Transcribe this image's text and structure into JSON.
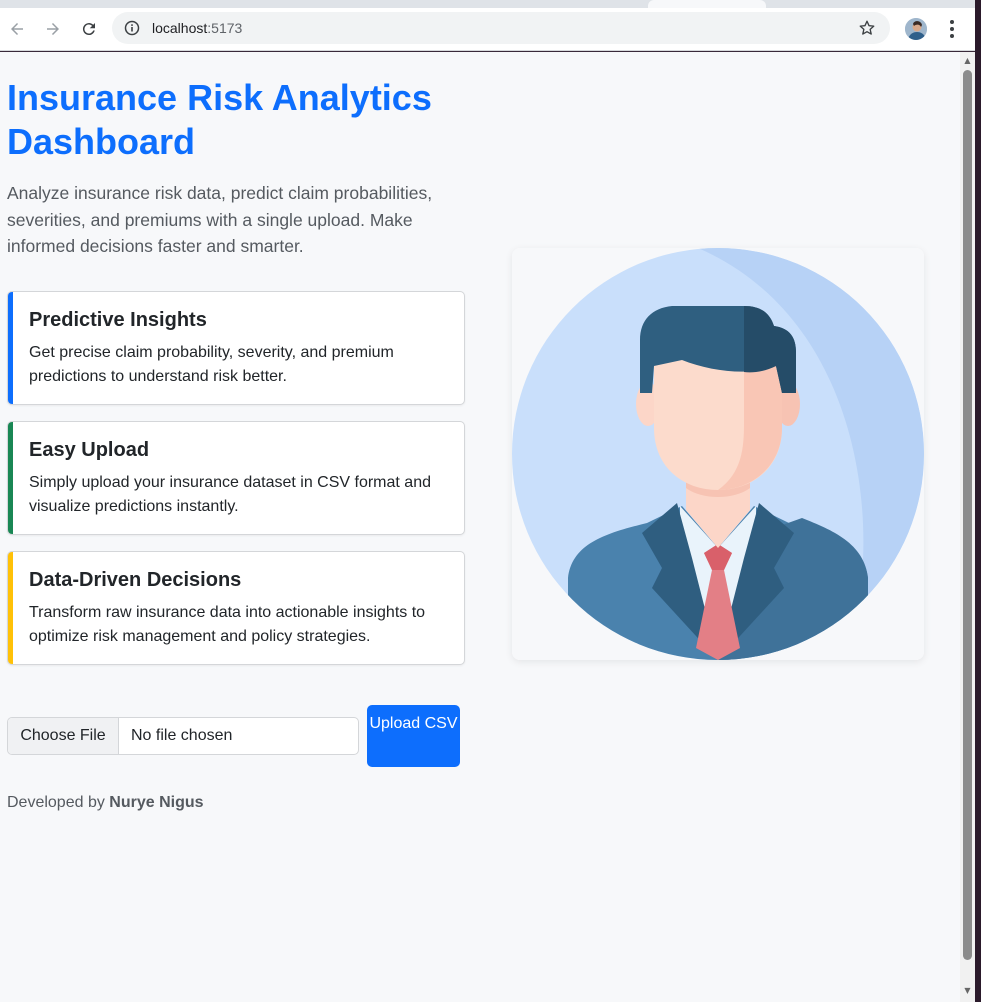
{
  "browser": {
    "url_host": "localhost",
    "url_port": ":5173"
  },
  "hero": {
    "title": "Insurance Risk Analytics Dashboard",
    "description": "Analyze insurance risk data, predict claim probabilities, severities, and premiums with a single upload. Make informed decisions faster and smarter."
  },
  "features": [
    {
      "title": "Predictive Insights",
      "text": "Get precise claim probability, severity, and premium predictions to understand risk better.",
      "accent": "#0d6efd"
    },
    {
      "title": "Easy Upload",
      "text": "Simply upload your insurance dataset in CSV format and visualize predictions instantly.",
      "accent": "#198754"
    },
    {
      "title": "Data-Driven Decisions",
      "text": "Transform raw insurance data into actionable insights to optimize risk management and policy strategies.",
      "accent": "#ffc107"
    }
  ],
  "upload": {
    "choose_label": "Choose File",
    "status": "No file chosen",
    "button_label": "Upload CSV"
  },
  "footer": {
    "prefix": "Developed by",
    "author": "Nurye Nigus"
  },
  "colors": {
    "primary": "#0d6efd",
    "background": "#f7f8fa"
  },
  "illustration": {
    "icon": "businessman-avatar-icon"
  }
}
